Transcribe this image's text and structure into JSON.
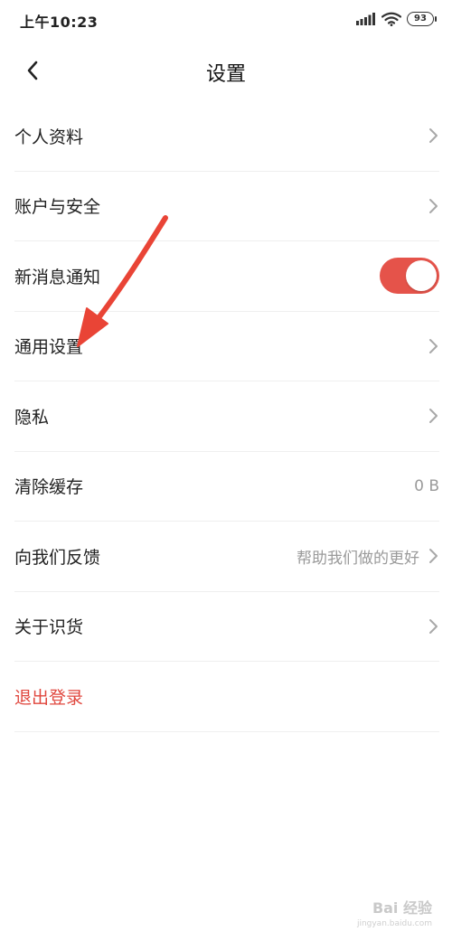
{
  "status_bar": {
    "time": "上午10:23",
    "battery": "93",
    "icons": [
      "signal-icon",
      "wifi-icon",
      "battery-icon"
    ]
  },
  "nav": {
    "title": "设置",
    "back_icon": "chevron-left-icon"
  },
  "settings": {
    "items": [
      {
        "label": "个人资料",
        "value": ""
      },
      {
        "label": "账户与安全",
        "value": ""
      },
      {
        "label": "新消息通知",
        "toggle_on": true
      },
      {
        "label": "通用设置",
        "value": ""
      },
      {
        "label": "隐私",
        "value": ""
      },
      {
        "label": "清除缓存",
        "value": "0 B"
      },
      {
        "label": "向我们反馈",
        "value": "帮助我们做的更好"
      },
      {
        "label": "关于识货",
        "value": ""
      }
    ],
    "logout": "退出登录"
  },
  "colors": {
    "accent": "#e5534a",
    "logout": "#e0473e",
    "arrow": "#e94436",
    "divider": "#efefef"
  },
  "watermark": {
    "main": "Bai 经验",
    "sub": "jingyan.baidu.com"
  }
}
